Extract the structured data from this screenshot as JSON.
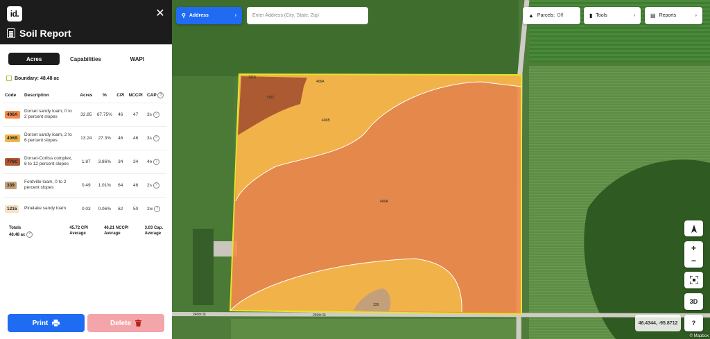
{
  "panel": {
    "logo": "id.",
    "title": "Soil Report",
    "tabs": [
      {
        "label": "Acres",
        "active": true
      },
      {
        "label": "Capabilities",
        "active": false
      },
      {
        "label": "WAPI",
        "active": false
      }
    ],
    "boundary": "Boundary: 48.48 ac",
    "headers": {
      "code": "Code",
      "description": "Description",
      "acres": "Acres",
      "pct": "%",
      "cpi": "CPI",
      "nccpi": "NCCPI",
      "cap": "CAP"
    },
    "rows": [
      {
        "code": "406A",
        "color": "#f2884a",
        "description": "Dorset sandy loam, 0 to 2 percent slopes",
        "acres": "32.85",
        "pct": "67.75%",
        "cpi": "46",
        "nccpi": "47",
        "cap": "3s"
      },
      {
        "code": "406B",
        "color": "#f0b64c",
        "description": "Dorset sandy loam, 2 to 6 percent slopes",
        "acres": "13.24",
        "pct": "27.3%",
        "cpi": "46",
        "nccpi": "46",
        "cap": "3s"
      },
      {
        "code": "776C",
        "color": "#b05a35",
        "description": "Dorset-Corliss complex, 6 to 12 percent slopes",
        "acres": "1.87",
        "pct": "3.86%",
        "cpi": "34",
        "nccpi": "34",
        "cap": "4e"
      },
      {
        "code": "339",
        "color": "#c4a07a",
        "description": "Fordville loam, 0 to 2 percent slopes",
        "acres": "0.49",
        "pct": "1.01%",
        "cpi": "64",
        "nccpi": "46",
        "cap": "2s"
      },
      {
        "code": "1215",
        "color": "#f6e2c6",
        "description": "Pinelake sandy loam",
        "acres": "0.03",
        "pct": "0.06%",
        "cpi": "62",
        "nccpi": "50",
        "cap": "2w"
      }
    ],
    "totals": {
      "label": "Totals",
      "acres": "48.48 ac",
      "cpi_value": "45.72 CPI",
      "cpi_label": "Average",
      "nccpi_value": "46.21 NCCPI",
      "nccpi_label": "Average",
      "cap_value": "3.03 Cap.",
      "cap_label": "Average"
    },
    "print_label": "Print",
    "delete_label": "Delete"
  },
  "map": {
    "address_button": "Address",
    "address_placeholder": "Enter Address (City, State, Zip)",
    "parcels_label": "Parcels:",
    "parcels_state": "Off",
    "tools_label": "Tools",
    "reports_label": "Reports",
    "zoom_in": "+",
    "zoom_out": "−",
    "mode_3d": "3D",
    "help": "?",
    "coords": "46.4344, -95.8712",
    "attribution": "© Mapbox",
    "labels": {
      "l406a": "406A",
      "l406b": "406B",
      "l776c": "776C",
      "l339": "339",
      "l1215": "1215",
      "l406a_top": "406A"
    },
    "roads": {
      "south": "240th St",
      "south2": "240th St"
    }
  },
  "colors": {
    "primary": "#1f6cf2",
    "danger": "#f4a5aa",
    "boundary": "#e5e52a"
  }
}
